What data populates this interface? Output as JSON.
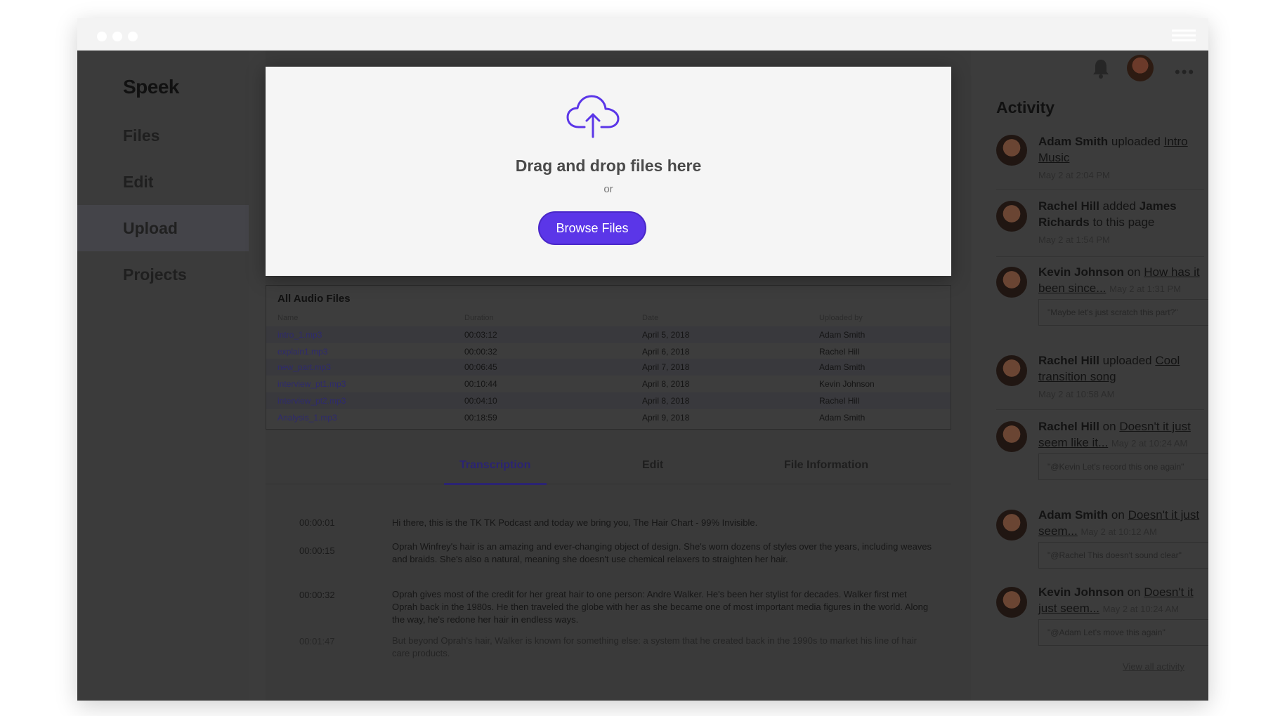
{
  "app": {
    "logo": "Speek"
  },
  "sidebar": {
    "items": [
      {
        "label": "Files"
      },
      {
        "label": "Edit"
      },
      {
        "label": "Upload"
      },
      {
        "label": "Projects"
      }
    ]
  },
  "upload": {
    "drop_text": "Drag and drop files here",
    "or_text": "or",
    "browse_label": "Browse Files",
    "accent": "#5b36e8"
  },
  "files": {
    "title": "All Audio Files",
    "columns": [
      "Name",
      "Duration",
      "Date",
      "Uploaded by"
    ],
    "rows": [
      [
        "intro_1.mp3",
        "00:03:12",
        "April 5, 2018",
        "Adam Smith"
      ],
      [
        "explain1.mp3",
        "00:00:32",
        "April 6, 2018",
        "Rachel Hill"
      ],
      [
        "new_part.mp3",
        "00:06:45",
        "April 7, 2018",
        "Adam Smith"
      ],
      [
        "interview_pt1.mp3",
        "00:10:44",
        "April 8, 2018",
        "Kevin Johnson"
      ],
      [
        "interview_pt2.mp3",
        "00:04:10",
        "April 8, 2018",
        "Rachel Hill"
      ],
      [
        "Analysis_1.mp3",
        "00:18:59",
        "April 9, 2018",
        "Adam Smith"
      ]
    ]
  },
  "tabs": [
    {
      "label": "Transcription"
    },
    {
      "label": "Edit"
    },
    {
      "label": "File Information"
    }
  ],
  "transcript": [
    {
      "time": "00:00:01",
      "text": "Hi there, this is the TK TK Podcast and today we bring you, The Hair Chart - 99% Invisible."
    },
    {
      "time": "00:00:15",
      "text": "Oprah Winfrey's hair is an amazing and ever-changing object of design. She's worn dozens of styles over the years, including weaves and braids. She's also a natural, meaning she doesn't use chemical relaxers to straighten her hair."
    },
    {
      "time": "00:00:32",
      "text": "Oprah gives most of the credit for her great hair to one person: Andre Walker. He's been her stylist for decades. Walker first met Oprah back in the 1980s. He then traveled the globe with her as she became one of most important media figures in the world. Along the way, he's redone her hair in endless ways."
    },
    {
      "time": "00:01:47",
      "text": "But beyond Oprah's hair, Walker is known for something else: a system that he created back in the 1990s to market his line of hair care products."
    }
  ],
  "activity": {
    "title": "Activity",
    "more": "•••",
    "view_all": "View all activity",
    "items": [
      {
        "name": "Adam Smith",
        "action": "uploaded",
        "target": "Intro Music",
        "time": "May 2 at 2:04 PM",
        "quote": ""
      },
      {
        "name": "Rachel Hill",
        "action": "added",
        "target": "James Richards",
        "suffix": "to this page",
        "time": "May 2 at 1:54 PM",
        "quote": ""
      },
      {
        "name": "Kevin Johnson",
        "action": "on",
        "target": "How has it been since...",
        "time": "May 2 at 1:31 PM",
        "quote": "\"Maybe let's just scratch this part?\""
      },
      {
        "name": "Rachel Hill",
        "action": "uploaded",
        "target": "Cool transition song",
        "time": "May 2 at 10:58 AM",
        "quote": ""
      },
      {
        "name": "Rachel Hill",
        "action": "on",
        "target": "Doesn't it just seem like it...",
        "time": "May 2 at 10:24 AM",
        "quote": "\"@Kevin Let's record this one again\""
      },
      {
        "name": "Adam Smith",
        "action": "on",
        "target": "Doesn't it just seem...",
        "time": "May 2 at 10:12 AM",
        "quote": "\"@Rachel This doesn't sound clear\""
      },
      {
        "name": "Kevin Johnson",
        "action": "on",
        "target": "Doesn't it just seem...",
        "time": "May 2 at 10:24 AM",
        "quote": "\"@Adam Let's move this again\""
      }
    ]
  }
}
